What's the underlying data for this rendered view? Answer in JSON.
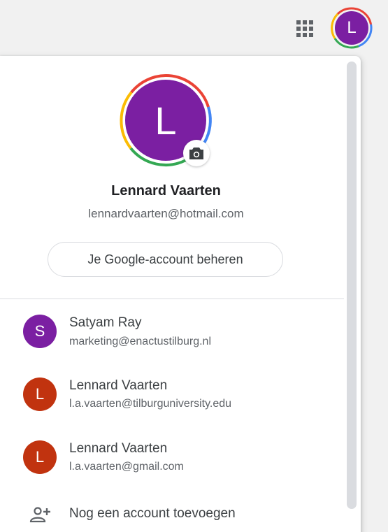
{
  "colors": {
    "avatar_purple": "#7b1fa2",
    "avatar_orange": "#c1330f",
    "google_red": "#ea4335",
    "google_yellow": "#fbbc04",
    "google_green": "#34a853",
    "google_blue": "#4285f4"
  },
  "header": {
    "apps_icon": "apps-grid-icon",
    "avatar_letter": "L"
  },
  "current_account": {
    "avatar_letter": "L",
    "camera_icon": "camera-icon",
    "name": "Lennard Vaarten",
    "email": "lennardvaarten@hotmail.com",
    "manage_label": "Je Google-account beheren"
  },
  "other_accounts": [
    {
      "avatar_letter": "S",
      "name": "Satyam Ray",
      "email": "marketing@enactustilburg.nl"
    },
    {
      "avatar_letter": "L",
      "name": "Lennard Vaarten",
      "email": "l.a.vaarten@tilburguniversity.edu"
    },
    {
      "avatar_letter": "L",
      "name": "Lennard Vaarten",
      "email": "l.a.vaarten@gmail.com"
    }
  ],
  "add_account": {
    "icon": "add-person-icon",
    "label": "Nog een account toevoegen"
  }
}
